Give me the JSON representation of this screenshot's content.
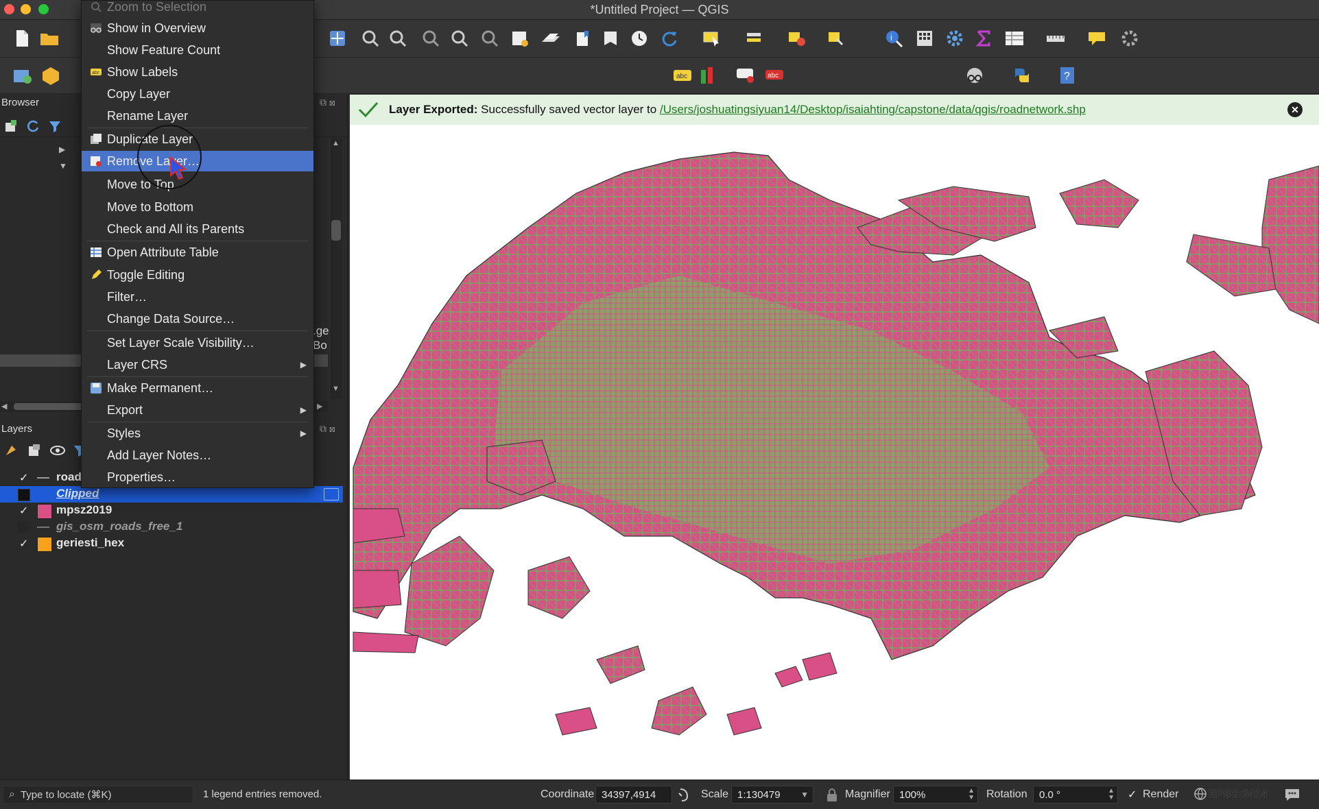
{
  "window": {
    "title": "*Untitled Project — QGIS"
  },
  "browser_panel": {
    "title": "Browser",
    "side_text_1": ".ge",
    "side_text_2": "Bo"
  },
  "layers_panel": {
    "title": "Layers",
    "layers": [
      {
        "name": "road",
        "checked": true,
        "symbol": "line",
        "style": "bold"
      },
      {
        "name": "Clipped",
        "checked": false,
        "symbol": "fill-dark",
        "style": "italic-selected"
      },
      {
        "name": "mpsz2019",
        "checked": true,
        "symbol": "fill-pink",
        "style": "bold"
      },
      {
        "name": "gis_osm_roads_free_1",
        "checked": false,
        "symbol": "line",
        "style": "italic-muted"
      },
      {
        "name": "geriesti_hex",
        "checked": true,
        "symbol": "fill-orange",
        "style": "bold"
      }
    ]
  },
  "context_menu": {
    "items": [
      {
        "label": "Zoom to Selection",
        "icon": "zoom-selection-icon",
        "disabled": true
      },
      {
        "label": "Show in Overview",
        "icon": "overview-icon"
      },
      {
        "label": "Show Feature Count",
        "icon": ""
      },
      {
        "label": "Show Labels",
        "icon": "labels-icon"
      },
      {
        "label": "Copy Layer",
        "icon": ""
      },
      {
        "label": "Rename Layer",
        "icon": ""
      },
      {
        "label": "Duplicate Layer",
        "icon": "duplicate-icon"
      },
      {
        "label": "Remove Layer…",
        "icon": "remove-icon",
        "highlighted": true
      },
      {
        "label": "Move to Top",
        "icon": ""
      },
      {
        "label": "Move to Bottom",
        "icon": ""
      },
      {
        "label": "Check and All its Parents",
        "icon": ""
      },
      {
        "label": "Open Attribute Table",
        "icon": "table-icon"
      },
      {
        "label": "Toggle Editing",
        "icon": "pencil-icon"
      },
      {
        "label": "Filter…",
        "icon": ""
      },
      {
        "label": "Change Data Source…",
        "icon": ""
      },
      {
        "label": "Set Layer Scale Visibility…",
        "icon": ""
      },
      {
        "label": "Layer CRS",
        "icon": "",
        "submenu": true
      },
      {
        "label": "Make Permanent…",
        "icon": "save-icon"
      },
      {
        "label": "Export",
        "icon": "",
        "submenu": true
      },
      {
        "label": "Styles",
        "icon": "",
        "submenu": true
      },
      {
        "label": "Add Layer Notes…",
        "icon": ""
      },
      {
        "label": "Properties…",
        "icon": ""
      }
    ]
  },
  "message_bar": {
    "title": "Layer Exported:",
    "text": "Successfully saved vector layer to",
    "link": "/Users/joshuatingsiyuan14/Desktop/isaiahting/capstone/data/qgis/roadnetwork.shp"
  },
  "status_bar": {
    "locate_placeholder": "Type to locate (⌘K)",
    "message": "1 legend entries removed.",
    "coordinate_label": "Coordinate",
    "coordinate_value": "34397,4914",
    "scale_label": "Scale",
    "scale_value": "1:130479",
    "magnifier_label": "Magnifier",
    "magnifier_value": "100%",
    "rotation_label": "Rotation",
    "rotation_value": "0.0 °",
    "render_label": "Render",
    "crs": "EPSG:3414"
  },
  "colors": {
    "polygon_fill": "#d95087",
    "road_lines": "#7aa462",
    "highlight": "#4a74c9",
    "message_bg": "#e2f1e0",
    "link": "#1f7a1f"
  }
}
